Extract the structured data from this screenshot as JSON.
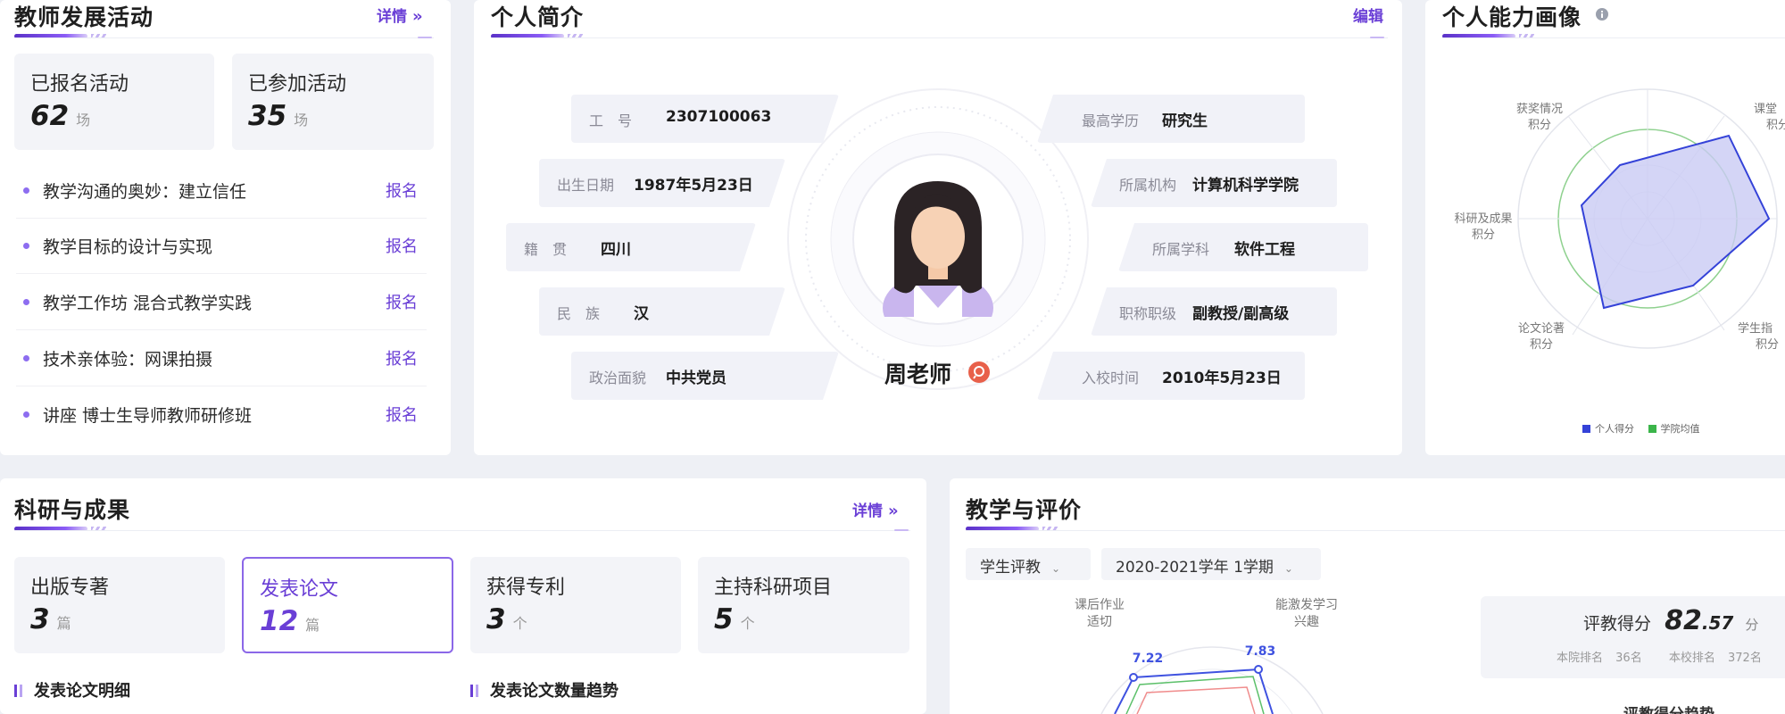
{
  "teacher_activity": {
    "title": "教师发展活动",
    "details_label": "详情",
    "stats": [
      {
        "label": "已报名活动",
        "value": "62",
        "unit": "场"
      },
      {
        "label": "已参加活动",
        "value": "35",
        "unit": "场"
      }
    ],
    "items": [
      {
        "text": "教学沟通的奥妙：建立信任",
        "action": "报名"
      },
      {
        "text": "教学目标的设计与实现",
        "action": "报名"
      },
      {
        "text": "教学工作坊 混合式教学实践",
        "action": "报名"
      },
      {
        "text": "技术亲体验：网课拍摄",
        "action": "报名"
      },
      {
        "text": "讲座 博士生导师教师研修班",
        "action": "报名"
      }
    ]
  },
  "profile": {
    "title": "个人简介",
    "edit_label": "编辑",
    "name": "周老师",
    "left_fields": [
      {
        "label": "工　号",
        "value": "2307100063"
      },
      {
        "label": "出生日期",
        "value": "1987年5月23日"
      },
      {
        "label": "籍　贯",
        "value": "四川"
      },
      {
        "label": "民　族",
        "value": "汉"
      },
      {
        "label": "政治面貌",
        "value": "中共党员"
      }
    ],
    "right_fields": [
      {
        "label": "最高学历",
        "value": "研究生"
      },
      {
        "label": "所属机构",
        "value": "计算机科学学院"
      },
      {
        "label": "所属学科",
        "value": "软件工程"
      },
      {
        "label": "职称职级",
        "value": "副教授/副高级"
      },
      {
        "label": "入校时间",
        "value": "2010年5月23日"
      }
    ]
  },
  "ability": {
    "title": "个人能力画像",
    "axes": [
      {
        "line1": "获奖情况",
        "line2": "积分"
      },
      {
        "line1": "课堂",
        "line2": "积分"
      },
      {
        "line1": "科研及成果",
        "line2": "积分"
      },
      {
        "line1": "论文论著",
        "line2": "积分"
      },
      {
        "line1": "学生指",
        "line2": "积分"
      }
    ],
    "legend": [
      {
        "name": "个人得分",
        "color": "#3442d8"
      },
      {
        "name": "学院均值",
        "color": "#3bb54a"
      }
    ]
  },
  "research": {
    "title": "科研与成果",
    "details_label": "详情",
    "stats": [
      {
        "label": "出版专著",
        "value": "3",
        "unit": "篇"
      },
      {
        "label": "发表论文",
        "value": "12",
        "unit": "篇"
      },
      {
        "label": "获得专利",
        "value": "3",
        "unit": "个"
      },
      {
        "label": "主持科研项目",
        "value": "5",
        "unit": "个"
      }
    ],
    "sub_detail": "发表论文明细",
    "sub_trend": "发表论文数量趋势"
  },
  "teaching": {
    "title": "教学与评价",
    "select_type": "学生评教",
    "select_term": "2020-2021学年 1学期",
    "axis_left": {
      "line1": "课后作业",
      "line2": "适切"
    },
    "axis_right": {
      "line1": "能激发学习",
      "line2": "兴趣"
    },
    "value_left": "7.22",
    "value_right": "7.83",
    "score_label": "评教得分",
    "score_int": "82",
    "score_dec": ".57",
    "score_unit": "分",
    "rank_college_label": "本院排名",
    "rank_college": "36名",
    "rank_school_label": "本校排名",
    "rank_school": "372名",
    "trend_label": "评教得分趋势"
  },
  "colors": {
    "accent": "#6a3fd6",
    "radar_fill": "#c9cbf4",
    "radar_line": "#3442d8"
  }
}
